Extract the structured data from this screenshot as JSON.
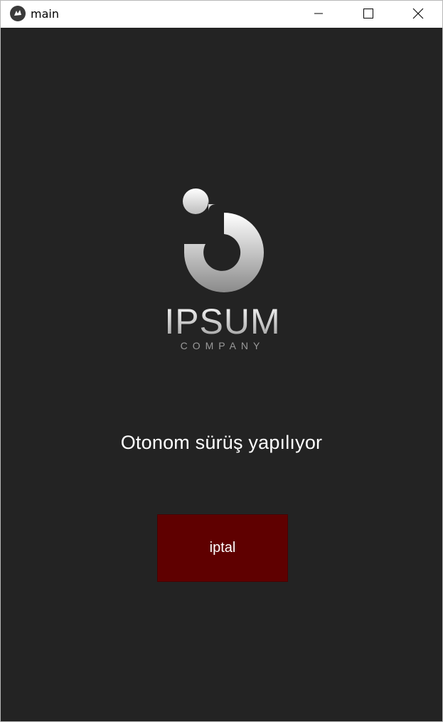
{
  "window": {
    "title": "main",
    "app_icon": "kivy-icon",
    "controls": {
      "minimize_icon": "minimize-icon",
      "maximize_icon": "maximize-icon",
      "close_icon": "close-icon"
    }
  },
  "logo": {
    "brand": "IPSUM",
    "subtitle": "COMPANY"
  },
  "status": {
    "message": "Otonom sürüş yapılıyor"
  },
  "actions": {
    "cancel_label": "iptal"
  },
  "colors": {
    "background": "#232323",
    "cancel_button": "#5f0000",
    "text": "#ffffff",
    "logo_gradient_top": "#ffffff",
    "logo_gradient_bottom": "#8a8a8a"
  }
}
